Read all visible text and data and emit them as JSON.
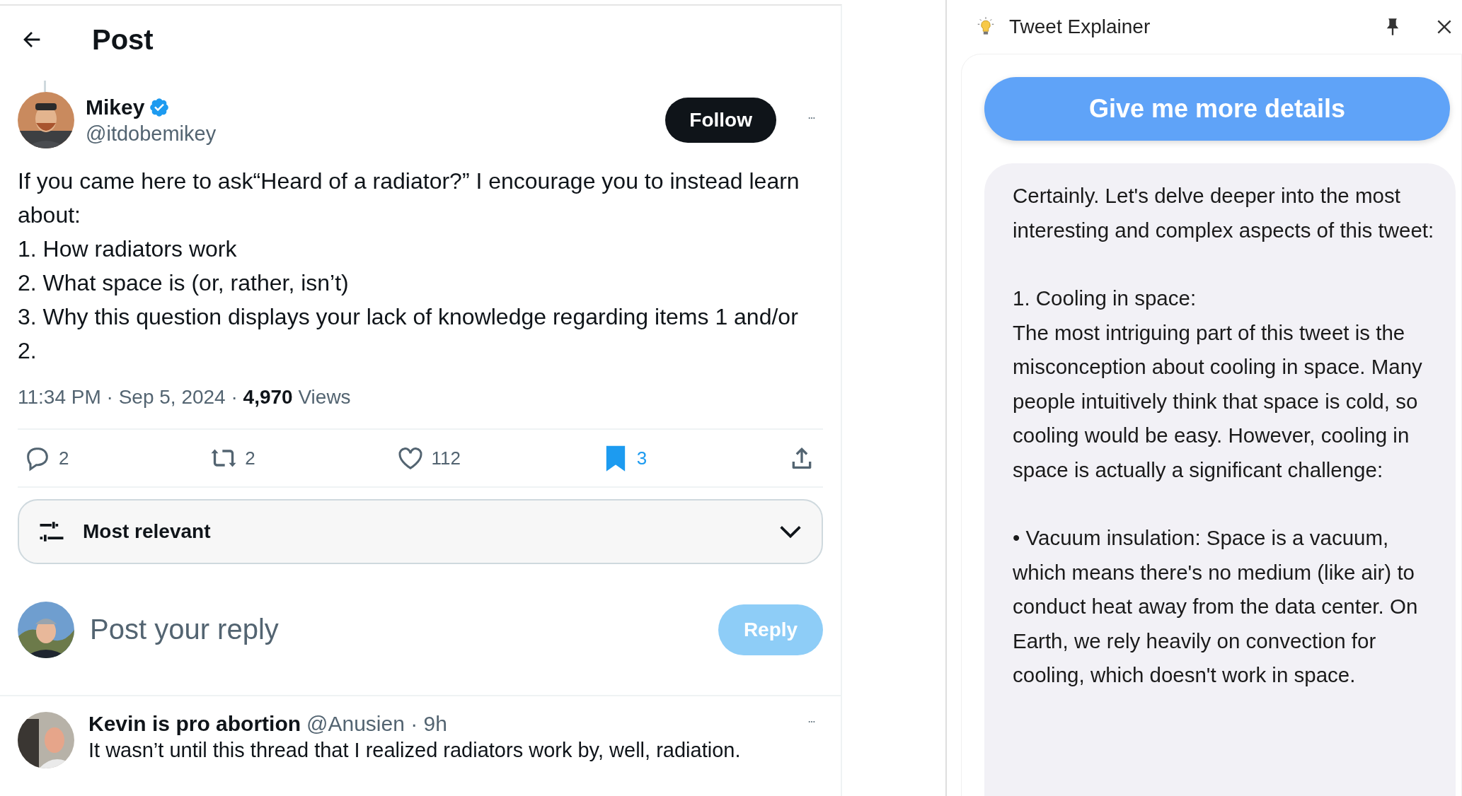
{
  "header": {
    "title": "Post"
  },
  "post": {
    "author": {
      "name": "Mikey",
      "verified": true,
      "handle": "@itdobemikey"
    },
    "follow_button": "Follow",
    "text": [
      "If you came here to ask“Heard of a radiator?” I encourage you to instead learn about:",
      "1. How radiators work",
      "2. What space is (or, rather, isn’t)",
      "3. Why this question displays your lack of knowledge regarding items 1 and/or 2."
    ],
    "meta": "11:34 PM · Sep 5, 2024 · **4,970** Views",
    "actions": [
      {
        "kind": "reply",
        "count": "2",
        "selected": false
      },
      {
        "kind": "repost",
        "count": "2",
        "selected": false
      },
      {
        "kind": "like",
        "count": "112",
        "selected": false
      },
      {
        "kind": "bookmark",
        "count": "3",
        "selected": true
      },
      {
        "kind": "share"
      }
    ]
  },
  "sort": {
    "label": "Most relevant"
  },
  "composer": {
    "placeholder": "Post your reply",
    "button": "Reply",
    "disabled": true
  },
  "replies": [
    {
      "name": "Kevin is pro abortion",
      "meta": "@Anusien · 9h",
      "text": "It wasn’t until this thread that I realized radiators work by, well, radiation."
    }
  ],
  "explainer": {
    "title": "Tweet Explainer",
    "button": "Give me more details",
    "paragraphs": [
      "Certainly. Let's delve deeper into the most interesting and complex aspects of this tweet:",
      "1. Cooling in space:\nThe most intriguing part of this tweet is the misconception about cooling in space. Many people intuitively think that space is cold, so cooling would be easy. However, cooling in space is actually a significant challenge:",
      "• Vacuum insulation: Space is a vacuum, which means there's no medium (like air) to conduct heat away from the data center. On Earth, we rely heavily on convection for cooling, which doesn't work in space."
    ]
  }
}
